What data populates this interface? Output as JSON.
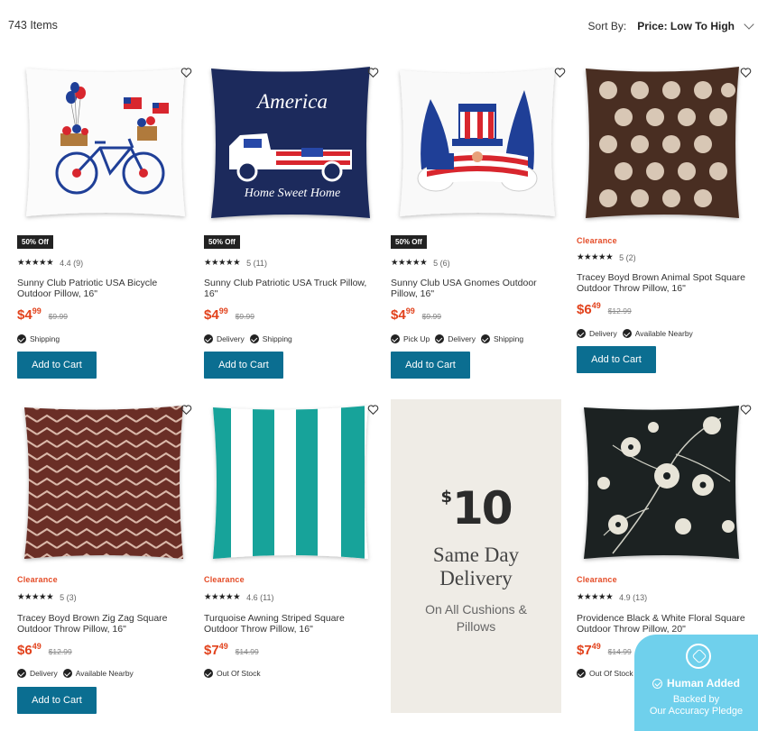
{
  "header": {
    "items_count": "743 Items",
    "sort_label": "Sort By:",
    "sort_value": "Price: Low To High"
  },
  "products": [
    {
      "badge": "50% Off",
      "stars": "★★★★★",
      "rating_text": "4.4 (9)",
      "title": "Sunny Club Patriotic USA Bicycle Outdoor Pillow, 16\"",
      "price_dollars": "$4",
      "price_cents": "99",
      "price_old": "$9.99",
      "fulfillment": [
        "Shipping"
      ],
      "button": "Add to Cart"
    },
    {
      "badge": "50% Off",
      "stars": "★★★★★",
      "rating_text": "5 (11)",
      "title": "Sunny Club Patriotic USA Truck Pillow, 16\"",
      "price_dollars": "$4",
      "price_cents": "99",
      "price_old": "$9.99",
      "fulfillment": [
        "Delivery",
        "Shipping"
      ],
      "button": "Add to Cart"
    },
    {
      "badge": "50% Off",
      "stars": "★★★★★",
      "rating_text": "5 (6)",
      "title": "Sunny Club USA Gnomes Outdoor Pillow, 16\"",
      "price_dollars": "$4",
      "price_cents": "99",
      "price_old": "$9.99",
      "fulfillment": [
        "Pick Up",
        "Delivery",
        "Shipping"
      ],
      "button": "Add to Cart"
    },
    {
      "badge": "Clearance",
      "stars": "★★★★★",
      "rating_text": "5 (2)",
      "title": "Tracey Boyd Brown Animal Spot Square Outdoor Throw Pillow, 16\"",
      "price_dollars": "$6",
      "price_cents": "49",
      "price_old": "$12.99",
      "fulfillment": [
        "Delivery",
        "Available Nearby"
      ],
      "button": "Add to Cart"
    },
    {
      "badge": "Clearance",
      "stars": "★★★★★",
      "rating_text": "5 (3)",
      "title": "Tracey Boyd Brown Zig Zag Square Outdoor Throw Pillow, 16\"",
      "price_dollars": "$6",
      "price_cents": "49",
      "price_old": "$12.99",
      "fulfillment": [
        "Delivery",
        "Available Nearby"
      ],
      "button": "Add to Cart"
    },
    {
      "badge": "Clearance",
      "stars": "★★★★★",
      "rating_text": "4.6 (11)",
      "title": "Turquoise Awning Striped Square Outdoor Throw Pillow, 16\"",
      "price_dollars": "$7",
      "price_cents": "49",
      "price_old": "$14.99",
      "fulfillment": [
        "Out Of Stock"
      ]
    },
    {
      "badge": "Clearance",
      "stars": "★★★★★",
      "rating_text": "4.9 (13)",
      "title": "Providence Black & White Floral Square Outdoor Throw Pillow, 20\"",
      "price_dollars": "$7",
      "price_cents": "49",
      "price_old": "$14.99",
      "fulfillment": [
        "Out Of Stock"
      ]
    }
  ],
  "images": {
    "p1": {
      "america": "",
      "home": ""
    },
    "p2": {
      "america": "America",
      "home": "Home Sweet Home"
    }
  },
  "promo": {
    "dollar": "$",
    "amount": "10",
    "headline_1": "Same Day",
    "headline_2": "Delivery",
    "sub_1": "On All Cushions &",
    "sub_2": "Pillows"
  },
  "pledge": {
    "title": "Human Added",
    "sub_1": "Backed by",
    "sub_2": "Our Accuracy Pledge"
  },
  "colors": {
    "cart_button": "#0b6e91",
    "sale_price": "#e2421c",
    "clearance": "#e44b26",
    "promo_bg": "#efece6",
    "pledge_bg": "#6fd0ec"
  }
}
